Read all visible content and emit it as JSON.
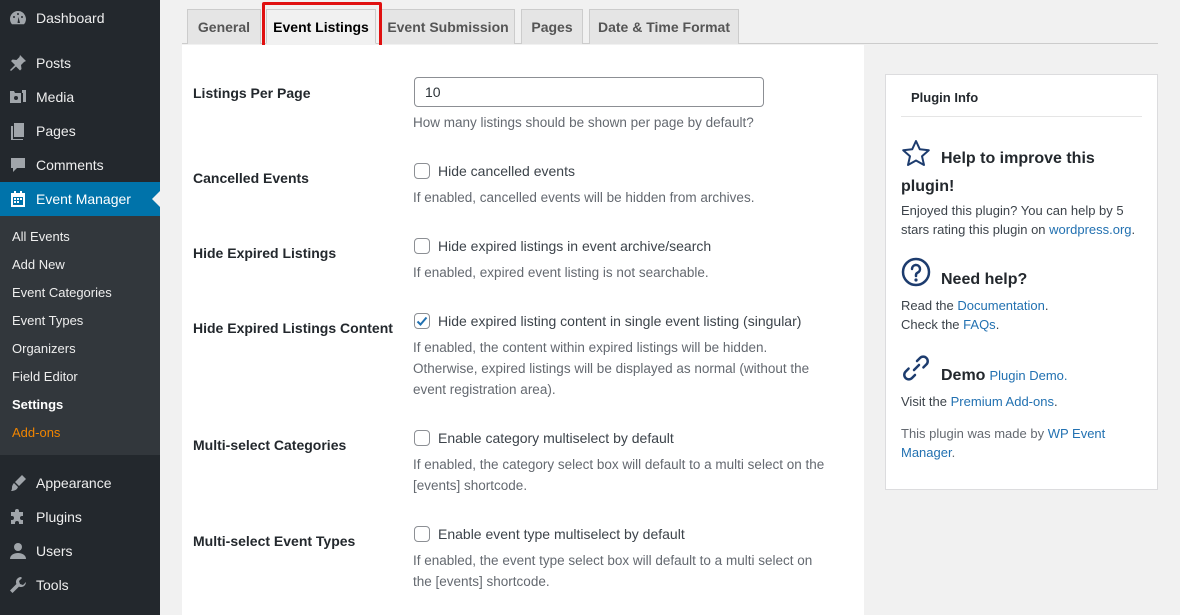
{
  "sidebar": {
    "top_items": [
      {
        "label": "Dashboard",
        "icon": "dashboard-icon"
      },
      {
        "label": "Posts",
        "icon": "pin-icon"
      },
      {
        "label": "Media",
        "icon": "media-icon"
      },
      {
        "label": "Pages",
        "icon": "pages-icon"
      },
      {
        "label": "Comments",
        "icon": "comment-icon"
      },
      {
        "label": "Event Manager",
        "icon": "calendar-icon"
      }
    ],
    "submenu": [
      "All Events",
      "Add New",
      "Event Categories",
      "Event Types",
      "Organizers",
      "Field Editor",
      "Settings",
      "Add-ons"
    ],
    "bottom_items": [
      {
        "label": "Appearance",
        "icon": "brush-icon"
      },
      {
        "label": "Plugins",
        "icon": "plugin-icon"
      },
      {
        "label": "Users",
        "icon": "user-icon"
      },
      {
        "label": "Tools",
        "icon": "wrench-icon"
      }
    ]
  },
  "tabs": [
    "General",
    "Event Listings",
    "Event Submission",
    "Pages",
    "Date & Time Format"
  ],
  "active_tab": "Event Listings",
  "settings": {
    "listings_per_page": {
      "label": "Listings Per Page",
      "value": "10",
      "desc": "How many listings should be shown per page by default?"
    },
    "cancelled_events": {
      "label": "Cancelled Events",
      "checkbox": "Hide cancelled events",
      "checked": false,
      "desc": "If enabled, cancelled events will be hidden from archives."
    },
    "hide_expired": {
      "label": "Hide Expired Listings",
      "checkbox": "Hide expired listings in event archive/search",
      "checked": false,
      "desc": "If enabled, expired event listing is not searchable."
    },
    "hide_expired_content": {
      "label": "Hide Expired Listings Content",
      "checkbox": "Hide expired listing content in single event listing (singular)",
      "checked": true,
      "desc_lines": [
        "If enabled, the content within expired listings will be hidden.",
        "Otherwise, expired listings will be displayed as normal (without the",
        "event registration area)."
      ]
    },
    "multiselect_categories": {
      "label": "Multi-select Categories",
      "checkbox": "Enable category multiselect by default",
      "checked": false,
      "desc_lines": [
        "If enabled, the category select box will default to a multi select on the",
        "[events] shortcode."
      ]
    },
    "multiselect_types": {
      "label": "Multi-select Event Types",
      "checkbox": "Enable event type multiselect by default",
      "checked": false,
      "desc_lines": [
        "If enabled, the event type select box will default to a multi select on",
        "the [events] shortcode."
      ]
    }
  },
  "plugin_info": {
    "title": "Plugin Info",
    "improve": {
      "heading_1": "Help to improve this",
      "heading_2": "plugin!",
      "text_1": "Enjoyed this plugin? You can help by 5",
      "text_2": "stars rating this plugin on",
      "link": "wordpress.org",
      "after": "."
    },
    "help": {
      "heading": "Need help?",
      "read_pre": "Read the",
      "doc_link": "Documentation",
      "check_pre": "Check the",
      "faq_link": "FAQs",
      "after": "."
    },
    "demo": {
      "heading": "Demo",
      "demo_link": "Plugin Demo.",
      "visit_pre": "Visit the",
      "addons_link": "Premium Add-ons",
      "after": "."
    },
    "made_by": {
      "pre": "This plugin was made by",
      "link_1": "WP Event",
      "link_2": "Manager",
      "after": "."
    }
  },
  "colors": {
    "sidebar_bg": "#23282d",
    "submenu_bg": "#32373c",
    "active_menu": "#0073aa",
    "addons": "#f18500",
    "link": "#2271b1",
    "highlight_box": "#e01010"
  }
}
